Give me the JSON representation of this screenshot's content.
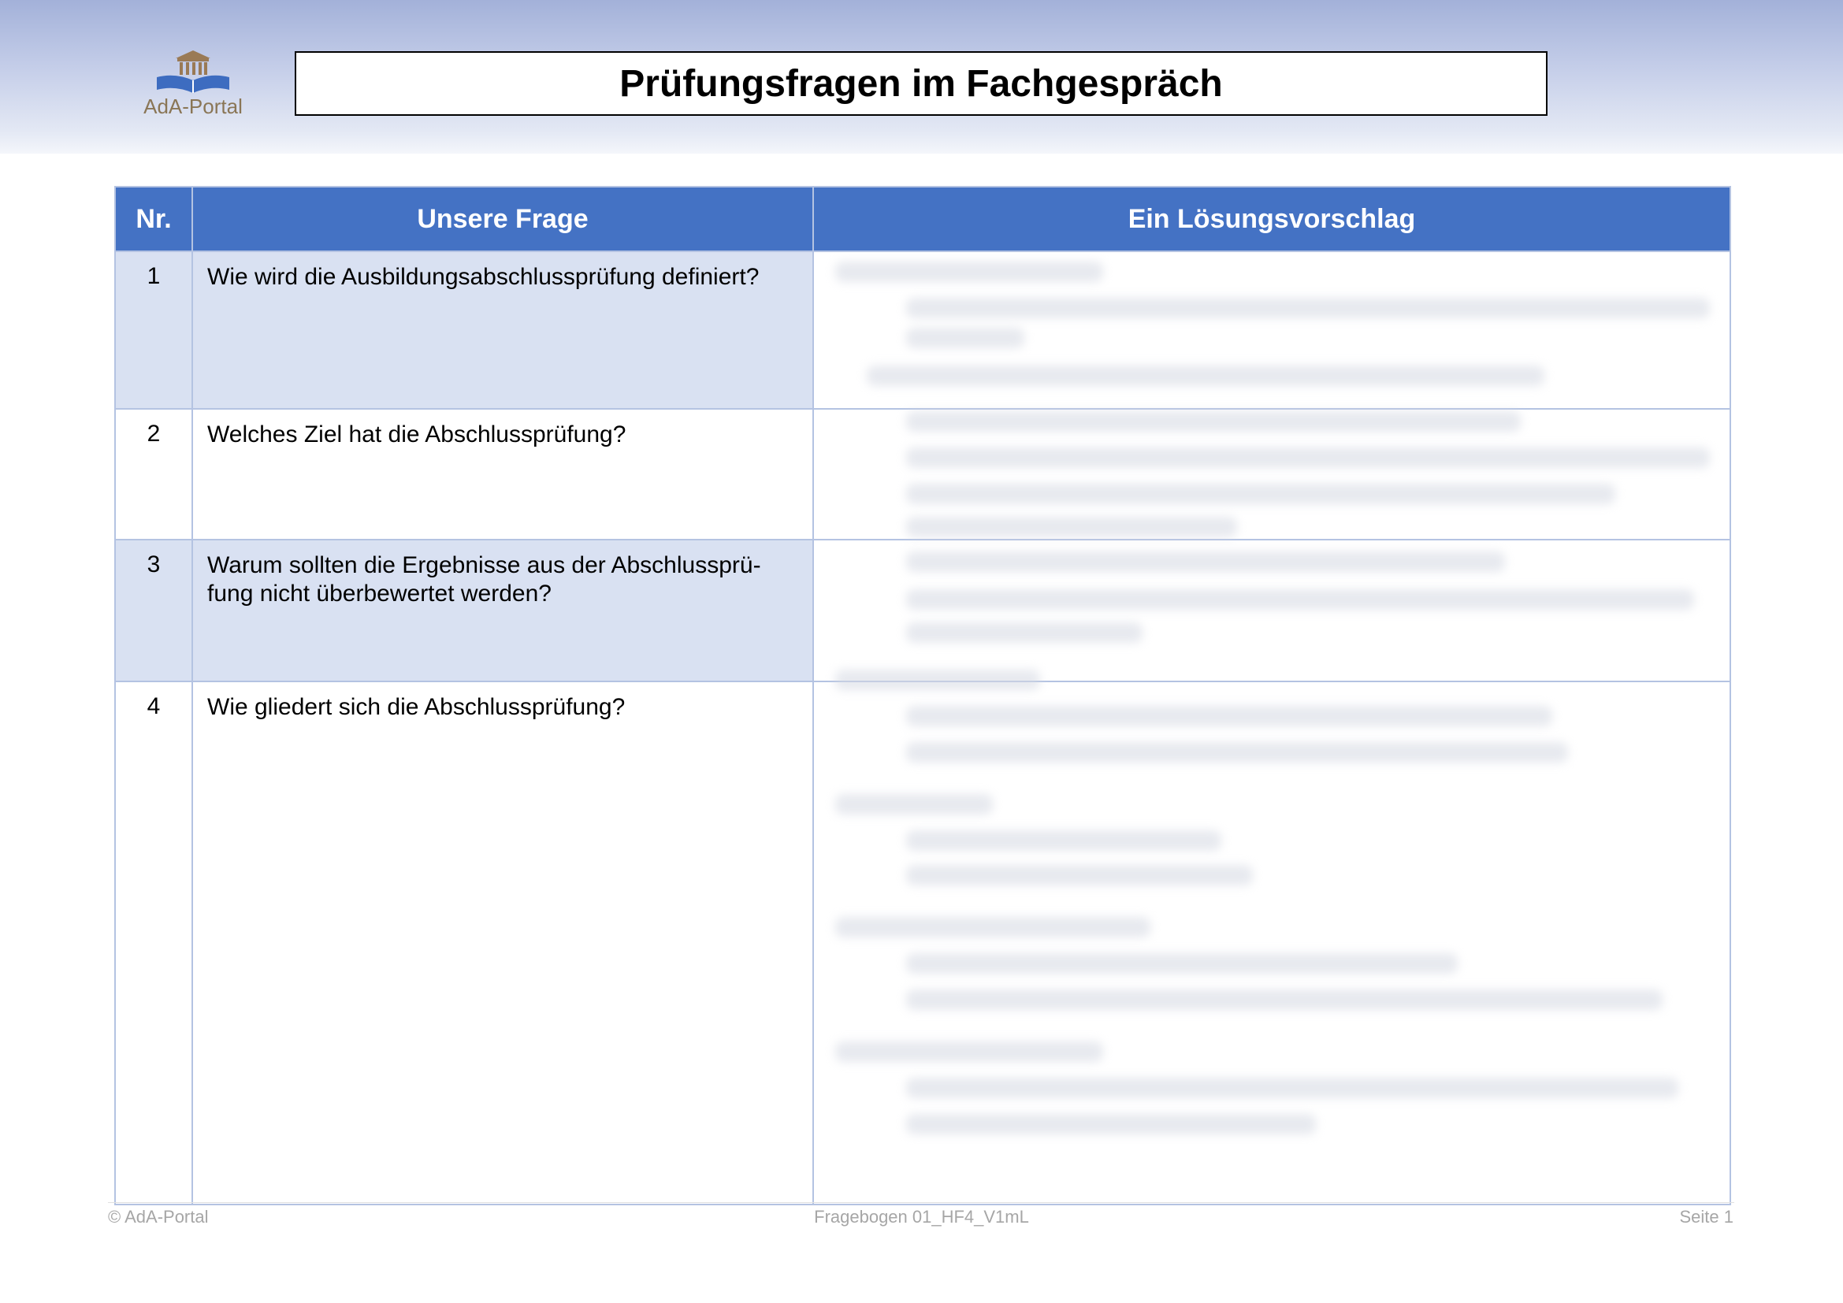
{
  "header": {
    "logo_text": "AdA-Portal",
    "title": "Prüfungsfragen im Fachgespräch"
  },
  "table": {
    "headers": [
      "Nr.",
      "Unsere Frage",
      "Ein Lösungsvorschlag"
    ],
    "rows": [
      {
        "nr": "1",
        "question": "Wie wird die Ausbildungsabschlussprüfung definiert?"
      },
      {
        "nr": "2",
        "question": "Welches Ziel hat die Abschlussprüfung?"
      },
      {
        "nr": "3",
        "question": "Warum sollten die Ergebnisse aus der Abschlussprü-fung nicht überbewertet werden?"
      },
      {
        "nr": "4",
        "question": "Wie gliedert sich die Abschlussprüfung?"
      }
    ]
  },
  "footer": {
    "left": "© AdA-Portal",
    "center": "Fragebogen 01_HF4_V1mL",
    "right": "Seite 1"
  },
  "colors": {
    "header_blue": "#4472c4",
    "row_shade": "#d9e1f2",
    "border": "#b4c3e2",
    "logo_brown": "#8a7656"
  }
}
